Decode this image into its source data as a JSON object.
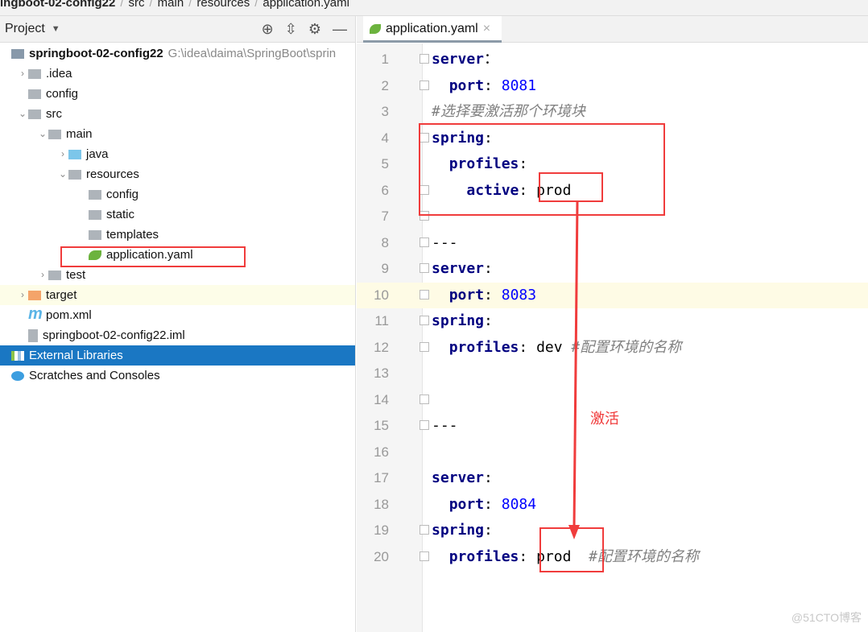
{
  "breadcrumb": [
    "ingboot-02-config22",
    "src",
    "main",
    "resources",
    "application.yaml"
  ],
  "project_panel": {
    "title": "Project",
    "icons": [
      "locate-icon",
      "collapse-icon",
      "gear-icon",
      "minimize-icon"
    ]
  },
  "tree": [
    {
      "label": "springboot-02-config22",
      "path": "G:\\idea\\daima\\SpringBoot\\sprin",
      "depth": 0,
      "bold": true
    },
    {
      "label": ".idea",
      "depth": 1,
      "arrow": "›"
    },
    {
      "label": "config",
      "depth": 1
    },
    {
      "label": "src",
      "depth": 1,
      "arrow": "⌄"
    },
    {
      "label": "main",
      "depth": 2,
      "arrow": "⌄"
    },
    {
      "label": "java",
      "depth": 3,
      "arrow": "›"
    },
    {
      "label": "resources",
      "depth": 3,
      "arrow": "⌄"
    },
    {
      "label": "config",
      "depth": 4
    },
    {
      "label": "static",
      "depth": 4
    },
    {
      "label": "templates",
      "depth": 4
    },
    {
      "label": "application.yaml",
      "depth": 4
    },
    {
      "label": "test",
      "depth": 2,
      "arrow": "›"
    },
    {
      "label": "target",
      "depth": 1,
      "arrow": "›"
    },
    {
      "label": "pom.xml",
      "depth": 1
    },
    {
      "label": "springboot-02-config22.iml",
      "depth": 1
    },
    {
      "label": "External Libraries",
      "depth": 0,
      "selected": true
    },
    {
      "label": "Scratches and Consoles",
      "depth": 0
    }
  ],
  "editor": {
    "tab": "application.yaml",
    "current_line": 10,
    "lines": [
      [
        [
          "k",
          "server"
        ],
        [
          "",
          "："
        ]
      ],
      [
        [
          "",
          "  "
        ],
        [
          "k",
          "port"
        ],
        [
          "",
          ": "
        ],
        [
          "n",
          "8081"
        ]
      ],
      [
        [
          "c",
          "#选择要激活那个环境块"
        ]
      ],
      [
        [
          "k",
          "spring"
        ],
        [
          "",
          ":"
        ]
      ],
      [
        [
          "",
          "  "
        ],
        [
          "k",
          "profiles"
        ],
        [
          "",
          ":"
        ]
      ],
      [
        [
          "",
          "    "
        ],
        [
          "k",
          "active"
        ],
        [
          "",
          ": prod"
        ]
      ],
      [],
      [
        [
          "",
          "---"
        ]
      ],
      [
        [
          "k",
          "server"
        ],
        [
          "",
          ":"
        ]
      ],
      [
        [
          "",
          "  "
        ],
        [
          "k",
          "port"
        ],
        [
          "",
          ": "
        ],
        [
          "n",
          "8083"
        ]
      ],
      [
        [
          "k",
          "spring"
        ],
        [
          "",
          ":"
        ]
      ],
      [
        [
          "",
          "  "
        ],
        [
          "k",
          "profiles"
        ],
        [
          "",
          ": dev "
        ],
        [
          "c",
          "#配置环境的名称"
        ]
      ],
      [],
      [],
      [
        [
          "",
          "---"
        ]
      ],
      [],
      [
        [
          "k",
          "server"
        ],
        [
          "",
          ":"
        ]
      ],
      [
        [
          "",
          "  "
        ],
        [
          "k",
          "port"
        ],
        [
          "",
          ": "
        ],
        [
          "n",
          "8084"
        ]
      ],
      [
        [
          "k",
          "spring"
        ],
        [
          "",
          ":"
        ]
      ],
      [
        [
          "",
          "  "
        ],
        [
          "k",
          "profiles"
        ],
        [
          "",
          ": prod  "
        ],
        [
          "c",
          "#配置环境的名称"
        ]
      ]
    ]
  },
  "annotation": "激活",
  "watermark": "@51CTO博客",
  "colors": {
    "annotation": "#f03c3c",
    "selection": "#1a77c3",
    "keyword": "#000080",
    "number": "#0000ff"
  }
}
